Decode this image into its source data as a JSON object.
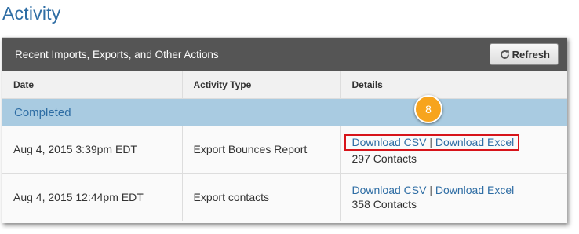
{
  "page": {
    "title": "Activity"
  },
  "panel": {
    "title": "Recent Imports, Exports, and Other Actions",
    "refresh_label": "Refresh"
  },
  "table": {
    "columns": [
      "Date",
      "Activity Type",
      "Details"
    ],
    "group_label": "Completed",
    "rows": [
      {
        "date": "Aug 4, 2015 3:39pm EDT",
        "activity": "Export Bounces Report",
        "link_csv": "Download CSV",
        "separator": "|",
        "link_excel": "Download Excel",
        "count": "297 Contacts",
        "highlighted": true
      },
      {
        "date": "Aug 4, 2015 12:44pm EDT",
        "activity": "Export contacts",
        "link_csv": "Download CSV",
        "separator": "|",
        "link_excel": "Download Excel",
        "count": "358 Contacts",
        "highlighted": false
      }
    ]
  },
  "callout": {
    "number": "8"
  },
  "colors": {
    "title_blue": "#2e6da4",
    "header_bg": "#555555",
    "group_bg": "#a9cbe1",
    "highlight_red": "#d7141a",
    "badge_orange": "#f7a41d"
  },
  "icons": {
    "refresh": "refresh-icon"
  }
}
